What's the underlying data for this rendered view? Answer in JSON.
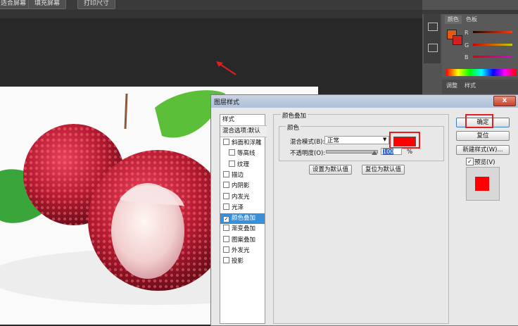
{
  "toolbar": {
    "btn1": "适合屏幕",
    "btn2": "填充屏幕",
    "btn3": "打印尺寸"
  },
  "panels": {
    "color_tab": "颜色",
    "swatches_tab": "色板",
    "r_label": "R",
    "g_label": "G",
    "b_label": "B",
    "adjust_tab": "调整",
    "styles_tab": "样式",
    "foreground_color": "#e05a10",
    "background_color": "#d02020"
  },
  "dialog": {
    "title": "图层样式",
    "close": "x",
    "styles_header": "样式",
    "blend_options": "混合选项:默认",
    "items": [
      {
        "label": "斜面和浮雕",
        "checked": false,
        "indent": false
      },
      {
        "label": "等高线",
        "checked": false,
        "indent": true
      },
      {
        "label": "纹理",
        "checked": false,
        "indent": true
      },
      {
        "label": "描边",
        "checked": false,
        "indent": false
      },
      {
        "label": "内阴影",
        "checked": false,
        "indent": false
      },
      {
        "label": "内发光",
        "checked": false,
        "indent": false
      },
      {
        "label": "光泽",
        "checked": false,
        "indent": false
      },
      {
        "label": "颜色叠加",
        "checked": true,
        "indent": false,
        "selected": true
      },
      {
        "label": "渐变叠加",
        "checked": false,
        "indent": false
      },
      {
        "label": "图案叠加",
        "checked": false,
        "indent": false
      },
      {
        "label": "外发光",
        "checked": false,
        "indent": false
      },
      {
        "label": "投影",
        "checked": false,
        "indent": false
      }
    ],
    "section_title": "颜色叠加",
    "subsection": "颜色",
    "blend_mode_label": "混合模式(B):",
    "blend_mode_value": "正常",
    "overlay_color": "#ff0000",
    "opacity_label": "不透明度(O):",
    "opacity_value": "100",
    "opacity_unit": "%",
    "set_default": "设置为默认值",
    "reset_default": "复位为默认值",
    "ok": "确定",
    "reset": "复位",
    "new_style": "新建样式(W)...",
    "preview_label": "预览(V)",
    "preview_checked": true,
    "highlight_color": "#e02020"
  }
}
